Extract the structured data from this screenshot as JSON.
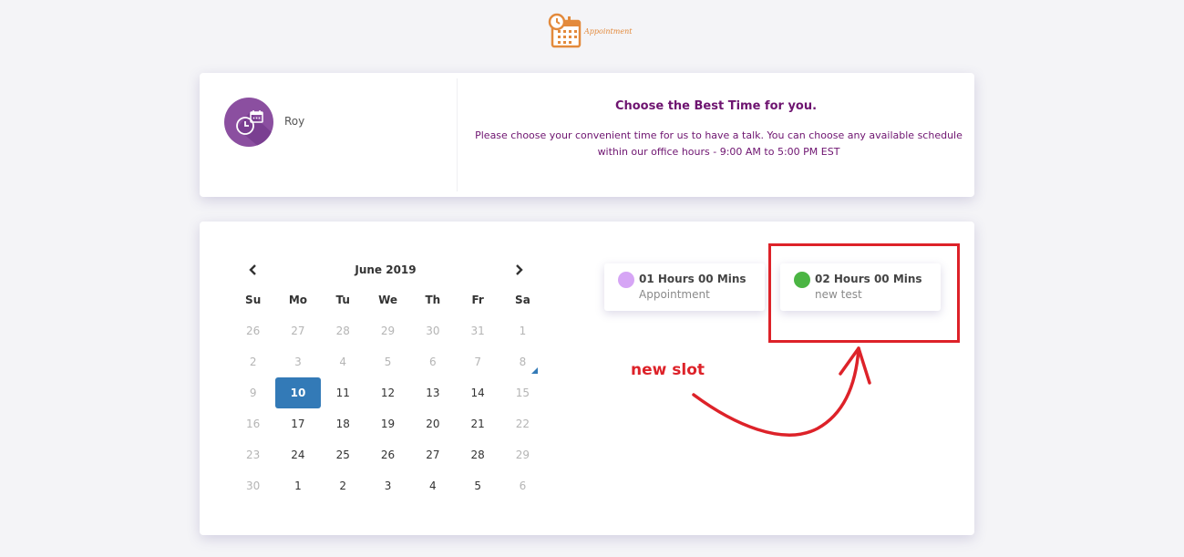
{
  "logo": {
    "icon": "calendar-clock-icon",
    "text": "Appointment",
    "color": "#e38a3c"
  },
  "profile": {
    "name": "Roy",
    "avatar_icon": "clock-calendar-icon",
    "avatar_color": "#8b4fa0"
  },
  "intro": {
    "title": "Choose the Best Time for you.",
    "description": "Please choose your convenient time for us to have a talk. You can choose any available schedule within our office hours - 9:00 AM to 5:00 PM EST",
    "color": "#6e1470"
  },
  "calendar": {
    "month_label": "June 2019",
    "prev_icon": "chevron-left-icon",
    "next_icon": "chevron-right-icon",
    "weekdays": [
      "Su",
      "Mo",
      "Tu",
      "We",
      "Th",
      "Fr",
      "Sa"
    ],
    "selected": "10",
    "selected_color": "#337ab7",
    "weeks": [
      [
        {
          "d": "26",
          "muted": true
        },
        {
          "d": "27",
          "muted": true
        },
        {
          "d": "28",
          "muted": true
        },
        {
          "d": "29",
          "muted": true
        },
        {
          "d": "30",
          "muted": true
        },
        {
          "d": "31",
          "muted": true
        },
        {
          "d": "1",
          "muted": true
        }
      ],
      [
        {
          "d": "2",
          "muted": true
        },
        {
          "d": "3",
          "muted": true
        },
        {
          "d": "4",
          "muted": true
        },
        {
          "d": "5",
          "muted": true
        },
        {
          "d": "6",
          "muted": true
        },
        {
          "d": "7",
          "muted": true
        },
        {
          "d": "8",
          "muted": true
        }
      ],
      [
        {
          "d": "9",
          "muted": true
        },
        {
          "d": "10",
          "muted": false
        },
        {
          "d": "11",
          "muted": false
        },
        {
          "d": "12",
          "muted": false
        },
        {
          "d": "13",
          "muted": false
        },
        {
          "d": "14",
          "muted": false
        },
        {
          "d": "15",
          "muted": true
        }
      ],
      [
        {
          "d": "16",
          "muted": true
        },
        {
          "d": "17",
          "muted": false
        },
        {
          "d": "18",
          "muted": false
        },
        {
          "d": "19",
          "muted": false
        },
        {
          "d": "20",
          "muted": false
        },
        {
          "d": "21",
          "muted": false
        },
        {
          "d": "22",
          "muted": true
        }
      ],
      [
        {
          "d": "23",
          "muted": true
        },
        {
          "d": "24",
          "muted": false
        },
        {
          "d": "25",
          "muted": false
        },
        {
          "d": "26",
          "muted": false
        },
        {
          "d": "27",
          "muted": false
        },
        {
          "d": "28",
          "muted": false
        },
        {
          "d": "29",
          "muted": true
        }
      ],
      [
        {
          "d": "30",
          "muted": true
        },
        {
          "d": "1",
          "muted": false
        },
        {
          "d": "2",
          "muted": false
        },
        {
          "d": "3",
          "muted": false
        },
        {
          "d": "4",
          "muted": false
        },
        {
          "d": "5",
          "muted": false
        },
        {
          "d": "6",
          "muted": true
        }
      ]
    ]
  },
  "slots": [
    {
      "duration": "01 Hours 00 Mins",
      "name": "Appointment",
      "color": "#d6a5f5"
    },
    {
      "duration": "02 Hours 00 Mins",
      "name": "new test",
      "color": "#4bb543"
    }
  ],
  "annotation": {
    "text": "new slot",
    "color": "#dd2229"
  }
}
